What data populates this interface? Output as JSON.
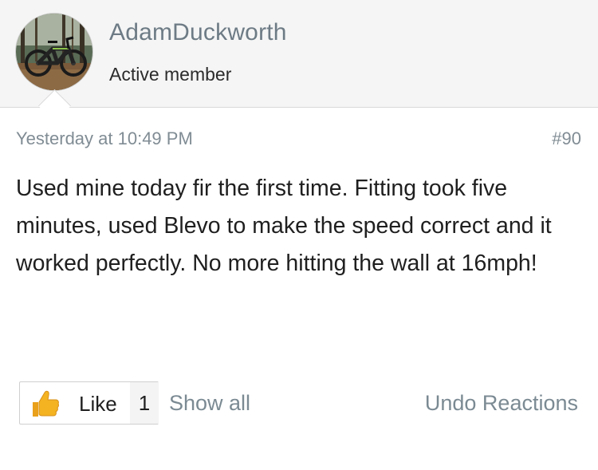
{
  "post": {
    "author": {
      "username": "AdamDuckworth",
      "title": "Active member",
      "avatar_icon": "avatar-bike-photo"
    },
    "timestamp": "Yesterday at 10:49 PM",
    "number": "#90",
    "body": "Used mine today fir the first time. Fitting took five minutes, used Blevo to make the speed correct and it worked perfectly. No more hitting the wall at 16mph!"
  },
  "reactions": {
    "icon": "thumbs-up-icon",
    "like_label": "Like",
    "like_count": "1",
    "show_all_label": "Show all",
    "undo_label": "Undo Reactions"
  },
  "colors": {
    "header_bg": "#f5f5f5",
    "muted_text": "#808c94",
    "username": "#6d7b85",
    "thumb": "#f4b321"
  }
}
